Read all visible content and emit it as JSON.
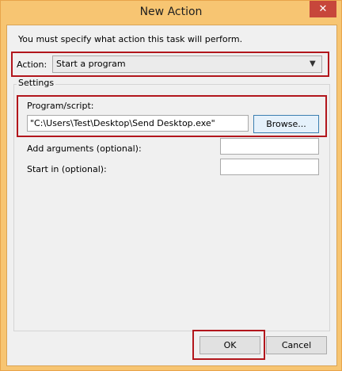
{
  "window": {
    "title": "New Action",
    "close_symbol": "✕"
  },
  "dialog": {
    "instruction": "You must specify what action this task will perform.",
    "action_label": "Action:",
    "action_selected": "Start a program",
    "settings_label": "Settings",
    "program_label": "Program/script:",
    "program_value": "\"C:\\Users\\Test\\Desktop\\Send Desktop.exe\"",
    "browse_label": "Browse...",
    "arguments_label": "Add arguments (optional):",
    "arguments_value": "",
    "start_in_label": "Start in (optional):",
    "start_in_value": ""
  },
  "buttons": {
    "ok": "OK",
    "cancel": "Cancel"
  },
  "colors": {
    "titlebar": "#f7c572",
    "highlight": "#b2161c",
    "close": "#c7463b"
  }
}
